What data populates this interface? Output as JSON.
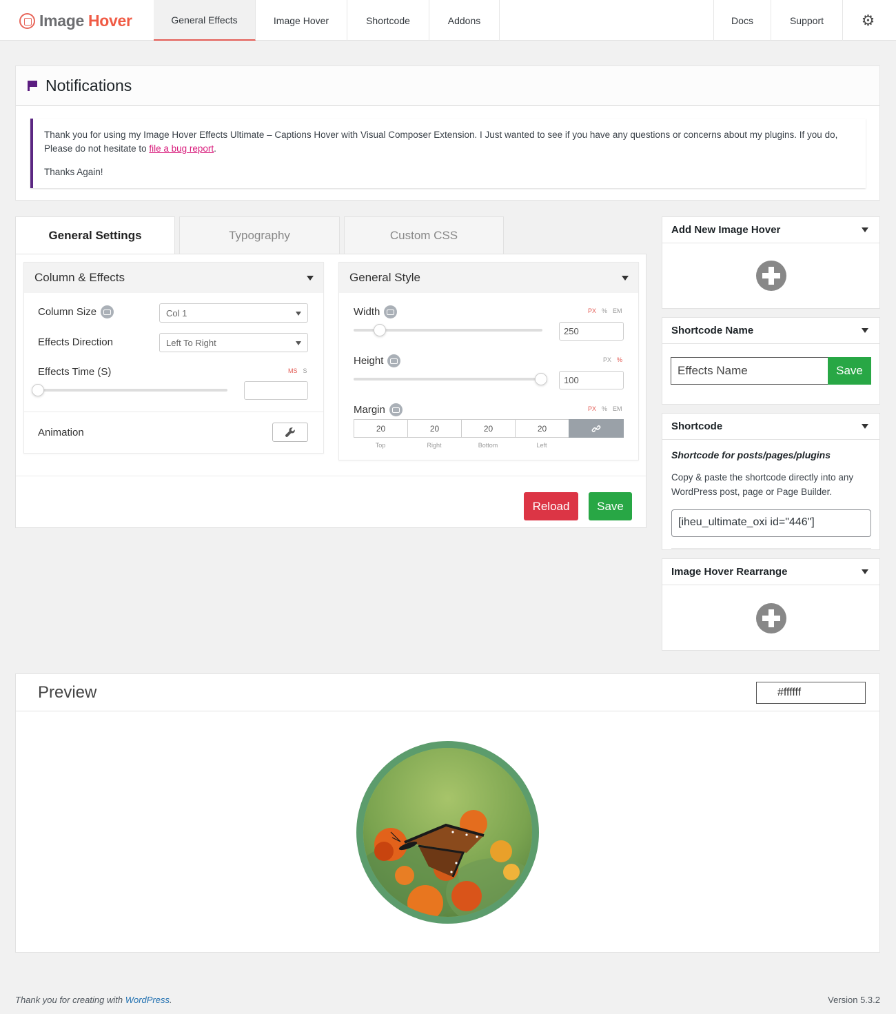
{
  "app": {
    "brand_a": "Image",
    "brand_b": "Hover"
  },
  "nav": {
    "tabs": [
      "General Effects",
      "Image Hover",
      "Shortcode",
      "Addons"
    ],
    "active_tab": "General Effects",
    "right": [
      "Docs",
      "Support"
    ],
    "settings_icon": "gear-icon"
  },
  "notifications": {
    "title": "Notifications",
    "message_before_link": "Thank you for using my Image Hover Effects Ultimate – Captions Hover with Visual Composer Extension. I Just wanted to see if you have any questions or concerns about my plugins. If you do, Please do not hesitate to ",
    "link": "file a bug report",
    "message_after_link": ".",
    "thanks": "Thanks Again!"
  },
  "settings_tabs": [
    "General Settings",
    "Typography",
    "Custom CSS"
  ],
  "column_effects": {
    "title": "Column & Effects",
    "column_size_label": "Column Size",
    "column_size_value": "Col 1",
    "effects_direction_label": "Effects Direction",
    "effects_direction_value": "Left To Right",
    "effects_time_label": "Effects Time (S)",
    "effects_time_units": [
      "MS",
      "S"
    ],
    "effects_time_active_unit": "MS",
    "effects_time_value": "",
    "effects_time_slider": 0,
    "animation_label": "Animation",
    "animation_icon": "wrench-icon"
  },
  "general_style": {
    "title": "General Style",
    "width_label": "Width",
    "width_units": [
      "PX",
      "%",
      "EM"
    ],
    "width_active_unit": "PX",
    "width_value": "250",
    "width_slider": 0.13,
    "height_label": "Height",
    "height_units": [
      "PX",
      "%"
    ],
    "height_active_unit": "%",
    "height_value": "100",
    "height_slider": 1.0,
    "margin_label": "Margin",
    "margin_units": [
      "PX",
      "%",
      "EM"
    ],
    "margin_active_unit": "PX",
    "margin_values": [
      "20",
      "20",
      "20",
      "20"
    ],
    "margin_sides": [
      "Top",
      "Right",
      "Bottom",
      "Left"
    ],
    "link_icon": "link-icon"
  },
  "actions": {
    "reload": "Reload",
    "save": "Save"
  },
  "sidebar": {
    "add_new": {
      "title": "Add New Image Hover",
      "icon": "plus-circle-icon"
    },
    "shortcode_name": {
      "title": "Shortcode Name",
      "value": "Effects Name",
      "save": "Save"
    },
    "shortcode": {
      "title": "Shortcode",
      "subtitle": "Shortcode for posts/pages/plugins",
      "text": "Copy & paste the shortcode directly into any WordPress post, page or Page Builder.",
      "value": "[iheu_ultimate_oxi id=\"446\"]"
    },
    "rearrange": {
      "title": "Image Hover Rearrange",
      "icon": "plus-circle-icon"
    }
  },
  "preview": {
    "title": "Preview",
    "bg_color": "#ffffff"
  },
  "footer": {
    "text": "Thank you for creating with ",
    "link": "WordPress",
    "suffix": ".",
    "version": "Version 5.3.2"
  },
  "colors": {
    "accent": "#e35b54",
    "brand": "#f05b45",
    "purple": "#5b2782",
    "red": "#dc3545",
    "green": "#28a745"
  }
}
